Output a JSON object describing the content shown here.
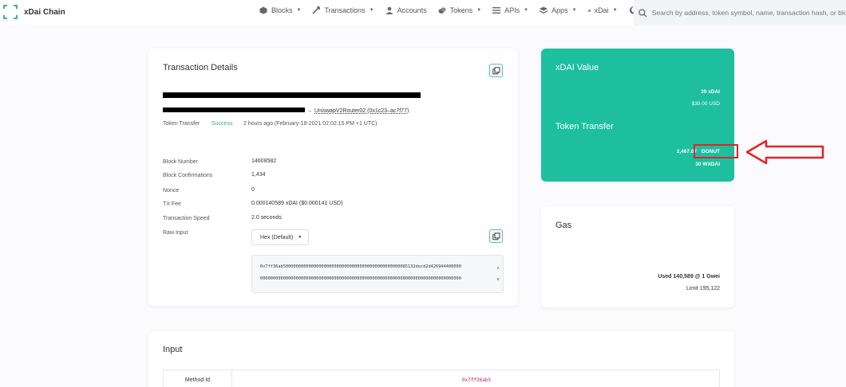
{
  "header": {
    "app_name": "xDai Chain",
    "nav": [
      {
        "label": "Blocks",
        "icon": "cube-icon",
        "caret": true
      },
      {
        "label": "Transactions",
        "icon": "arrows-icon",
        "caret": true
      },
      {
        "label": "Accounts",
        "icon": "user-icon",
        "caret": false
      },
      {
        "label": "Tokens",
        "icon": "coins-icon",
        "caret": true
      },
      {
        "label": "APIs",
        "icon": "list-icon",
        "caret": true
      },
      {
        "label": "Apps",
        "icon": "layers-icon",
        "caret": true
      },
      {
        "label": "xDai",
        "icon": "dot-icon",
        "caret": true
      }
    ],
    "search_placeholder": "Search by address, token symbol, name, transaction hash, or block"
  },
  "tx": {
    "title": "Transaction Details",
    "to_contract": "UniswapV2Router02 (0x1c23–ac7f77)",
    "type": "Token Transfer",
    "status": "Success",
    "time": "2 hours ago (February-18-2021 02:02:15 PM +1 UTC)",
    "rows": [
      {
        "label": "Block Number",
        "value": "14608582",
        "link": true
      },
      {
        "label": "Block Confirmations",
        "value": "1,434",
        "link": false
      },
      {
        "label": "Nonce",
        "value": "0",
        "link": false
      },
      {
        "label": "TX Fee",
        "value": "0.000140589 xDAI ($0.000141 USD)",
        "link": false
      },
      {
        "label": "Transaction Speed",
        "value": "2.0 seconds",
        "link": false
      }
    ],
    "raw_input_label": "Raw Input",
    "raw_format": "Hex (Default)",
    "raw_lines": [
      "0x7ff36ab5000000000000000000000000000000000000000000000085132decd2d426944400000",
      "0000000000000000000000000000000000000000000000000000000080000000000000000000000"
    ]
  },
  "value_card": {
    "title": "xDAI Value",
    "amount": "30 xDAI",
    "usd": "$30.00 USD",
    "transfer_title": "Token Transfer",
    "transfer_amount": "2,467.07",
    "transfer_token": "DONUT",
    "transfer_in": "30 WXDAI"
  },
  "gas": {
    "title": "Gas",
    "used": "Used 140,589 @ 1 Gwei",
    "limit": "Limit 195,122"
  },
  "input": {
    "title": "Input",
    "method_label": "Method Id",
    "method_value": "0x7ff36ab5"
  },
  "colors": {
    "accent": "#1dbf9f",
    "success": "#2db46b",
    "annotation": "#e0242a"
  }
}
